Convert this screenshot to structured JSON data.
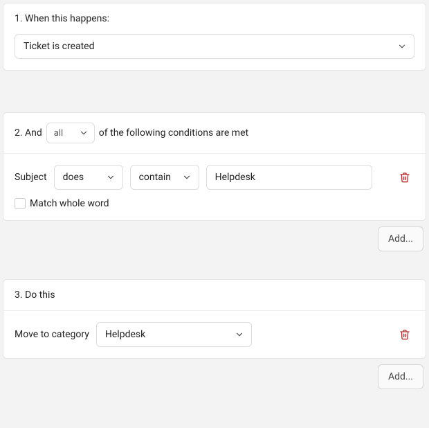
{
  "step1": {
    "title": "1. When this happens:",
    "trigger": "Ticket is created"
  },
  "step2": {
    "title_prefix": "2. And",
    "match_mode": "all",
    "title_suffix": "of the following conditions are met",
    "condition": {
      "field": "Subject",
      "op1": "does",
      "op2": "contain",
      "value": "Helpdesk",
      "match_whole_word_label": "Match whole word",
      "match_whole_word_checked": false
    },
    "add_label": "Add..."
  },
  "step3": {
    "title": "3. Do this",
    "action_label": "Move to category",
    "action_value": "Helpdesk",
    "add_label": "Add..."
  }
}
